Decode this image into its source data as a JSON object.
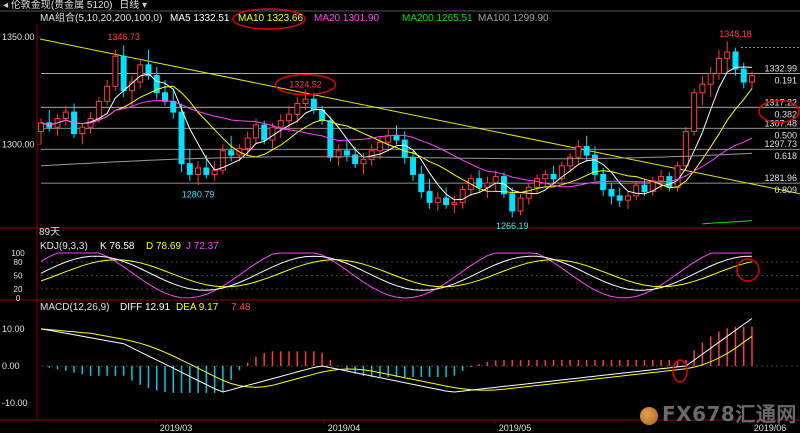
{
  "toolbar": {
    "title": "伦敦金现",
    "title_sub": "(贵金属 5120)",
    "period": "日线"
  },
  "main_panel": {
    "ma_title": "MA组合(5,10,20,200,100,0)",
    "ma_entries": [
      {
        "label": "MA5",
        "value": "1332.51",
        "color": "#ffffff"
      },
      {
        "label": "MA10",
        "value": "1323.66",
        "color": "#ffff00",
        "circled": true
      },
      {
        "label": "MA20",
        "value": "1301.90",
        "color": "#ff40ff"
      },
      {
        "label": "MA200",
        "value": "1265.51",
        "color": "#00e000"
      },
      {
        "label": "MA100",
        "value": "1299.90",
        "color": "#a0a0a0"
      }
    ],
    "y_ticks": [
      "1350.00",
      "1300.00"
    ],
    "price_labels": [
      {
        "text": "1346.73",
        "color": "#ff4040"
      },
      {
        "text": "1324.52",
        "color": "#ff4040",
        "circled": true
      },
      {
        "text": "1348.18",
        "color": "#ff4040"
      },
      {
        "text": "1280.79",
        "color": "#40e0ff"
      },
      {
        "text": "1266.19",
        "color": "#40e0ff"
      }
    ],
    "fib_levels": [
      {
        "price": "1332.99",
        "ratio": "0.191"
      },
      {
        "price": "1317.22",
        "ratio": "0.382",
        "circled": true
      },
      {
        "price": "1307.48",
        "ratio": "0.500"
      },
      {
        "price": "1297.73",
        "ratio": "0.618"
      },
      {
        "price": "1281.96",
        "ratio": "0.809"
      }
    ],
    "days_label": "89天"
  },
  "kdj_panel": {
    "title": "KDJ(9,3,3)",
    "entries": [
      {
        "label": "K",
        "value": "76.58",
        "color": "#ffffff"
      },
      {
        "label": "D",
        "value": "78.69",
        "color": "#ffff00"
      },
      {
        "label": "J",
        "value": "72.37",
        "color": "#ff40ff"
      }
    ],
    "y_ticks": [
      "100",
      "80",
      "50",
      "20",
      "0"
    ]
  },
  "macd_panel": {
    "title": "MACD(12,26,9)",
    "entries": [
      {
        "label": "DIFF",
        "value": "12.91",
        "color": "#ffffff"
      },
      {
        "label": "DEA",
        "value": "9.17",
        "color": "#ffff00"
      },
      {
        "label": "",
        "value": "7.48",
        "color": "#ff4040"
      }
    ],
    "y_ticks": [
      "10.00",
      "0.00",
      "-10.00"
    ]
  },
  "x_axis": {
    "labels": [
      "2019/03",
      "2019/04",
      "2019/05",
      "2019/06"
    ]
  },
  "watermark": "FX678汇通网",
  "chart_data": {
    "type": "candlestick",
    "price_axis": {
      "ticks": [
        1350.0,
        1300.0
      ]
    },
    "annotations": {
      "high_feb": 1346.73,
      "high_apr": 1324.52,
      "high_jun": 1348.18,
      "low_mar": 1280.79,
      "low_may": 1266.19
    },
    "fibonacci": [
      {
        "ratio": 0.191,
        "price": 1332.99
      },
      {
        "ratio": 0.382,
        "price": 1317.22
      },
      {
        "ratio": 0.5,
        "price": 1307.48
      },
      {
        "ratio": 0.618,
        "price": 1297.73
      },
      {
        "ratio": 0.809,
        "price": 1281.96
      }
    ],
    "ohlc": [
      [
        1306,
        1312,
        1300,
        1310
      ],
      [
        1310,
        1316,
        1306,
        1308
      ],
      [
        1308,
        1314,
        1304,
        1312
      ],
      [
        1312,
        1318,
        1309,
        1315
      ],
      [
        1315,
        1319,
        1303,
        1305
      ],
      [
        1305,
        1310,
        1300,
        1308
      ],
      [
        1308,
        1315,
        1305,
        1312
      ],
      [
        1312,
        1322,
        1310,
        1320
      ],
      [
        1320,
        1330,
        1318,
        1327
      ],
      [
        1327,
        1344,
        1325,
        1341
      ],
      [
        1341,
        1346,
        1322,
        1325
      ],
      [
        1325,
        1332,
        1318,
        1329
      ],
      [
        1329,
        1340,
        1326,
        1337
      ],
      [
        1337,
        1344,
        1330,
        1332
      ],
      [
        1332,
        1336,
        1321,
        1324
      ],
      [
        1324,
        1330,
        1318,
        1320
      ],
      [
        1320,
        1326,
        1312,
        1315
      ],
      [
        1315,
        1319,
        1287,
        1291
      ],
      [
        1291,
        1298,
        1283,
        1286
      ],
      [
        1286,
        1292,
        1281,
        1289
      ],
      [
        1289,
        1295,
        1284,
        1286
      ],
      [
        1286,
        1292,
        1283,
        1288
      ],
      [
        1288,
        1300,
        1286,
        1297
      ],
      [
        1297,
        1304,
        1292,
        1295
      ],
      [
        1295,
        1300,
        1292,
        1298
      ],
      [
        1298,
        1306,
        1295,
        1303
      ],
      [
        1303,
        1312,
        1300,
        1309
      ],
      [
        1309,
        1311,
        1300,
        1302
      ],
      [
        1302,
        1310,
        1298,
        1308
      ],
      [
        1308,
        1314,
        1303,
        1311
      ],
      [
        1311,
        1318,
        1306,
        1314
      ],
      [
        1314,
        1322,
        1310,
        1319
      ],
      [
        1319,
        1325,
        1316,
        1321
      ],
      [
        1321,
        1324,
        1314,
        1316
      ],
      [
        1316,
        1318,
        1309,
        1311
      ],
      [
        1311,
        1313,
        1292,
        1294
      ],
      [
        1294,
        1300,
        1290,
        1297
      ],
      [
        1297,
        1302,
        1292,
        1295
      ],
      [
        1295,
        1299,
        1289,
        1291
      ],
      [
        1291,
        1296,
        1286,
        1293
      ],
      [
        1293,
        1300,
        1290,
        1297
      ],
      [
        1297,
        1304,
        1293,
        1301
      ],
      [
        1301,
        1307,
        1298,
        1304
      ],
      [
        1304,
        1309,
        1300,
        1302
      ],
      [
        1302,
        1306,
        1291,
        1294
      ],
      [
        1294,
        1297,
        1283,
        1286
      ],
      [
        1286,
        1290,
        1275,
        1278
      ],
      [
        1278,
        1284,
        1270,
        1273
      ],
      [
        1273,
        1278,
        1269,
        1275
      ],
      [
        1275,
        1280,
        1270,
        1272
      ],
      [
        1272,
        1276,
        1268,
        1273
      ],
      [
        1273,
        1281,
        1270,
        1279
      ],
      [
        1279,
        1286,
        1276,
        1284
      ],
      [
        1284,
        1288,
        1278,
        1280
      ],
      [
        1280,
        1285,
        1275,
        1282
      ],
      [
        1282,
        1288,
        1278,
        1285
      ],
      [
        1285,
        1287,
        1275,
        1277
      ],
      [
        1277,
        1280,
        1266,
        1269
      ],
      [
        1269,
        1277,
        1267,
        1275
      ],
      [
        1275,
        1282,
        1272,
        1280
      ],
      [
        1280,
        1286,
        1277,
        1284
      ],
      [
        1284,
        1288,
        1280,
        1286
      ],
      [
        1286,
        1290,
        1282,
        1284
      ],
      [
        1284,
        1292,
        1282,
        1290
      ],
      [
        1290,
        1296,
        1287,
        1294
      ],
      [
        1294,
        1302,
        1291,
        1299
      ],
      [
        1299,
        1304,
        1292,
        1295
      ],
      [
        1295,
        1299,
        1283,
        1286
      ],
      [
        1286,
        1289,
        1276,
        1279
      ],
      [
        1279,
        1282,
        1272,
        1276
      ],
      [
        1276,
        1280,
        1271,
        1274
      ],
      [
        1274,
        1278,
        1270,
        1276
      ],
      [
        1276,
        1283,
        1274,
        1281
      ],
      [
        1281,
        1284,
        1276,
        1278
      ],
      [
        1278,
        1285,
        1276,
        1283
      ],
      [
        1283,
        1288,
        1279,
        1285
      ],
      [
        1285,
        1287,
        1278,
        1280
      ],
      [
        1280,
        1292,
        1278,
        1290
      ],
      [
        1290,
        1308,
        1288,
        1306
      ],
      [
        1306,
        1326,
        1304,
        1324
      ],
      [
        1324,
        1332,
        1318,
        1328
      ],
      [
        1328,
        1336,
        1322,
        1333
      ],
      [
        1333,
        1344,
        1330,
        1340
      ],
      [
        1340,
        1348,
        1334,
        1343
      ],
      [
        1343,
        1345,
        1332,
        1335
      ],
      [
        1335,
        1338,
        1326,
        1329
      ],
      [
        1329,
        1334,
        1326,
        1332
      ]
    ]
  }
}
